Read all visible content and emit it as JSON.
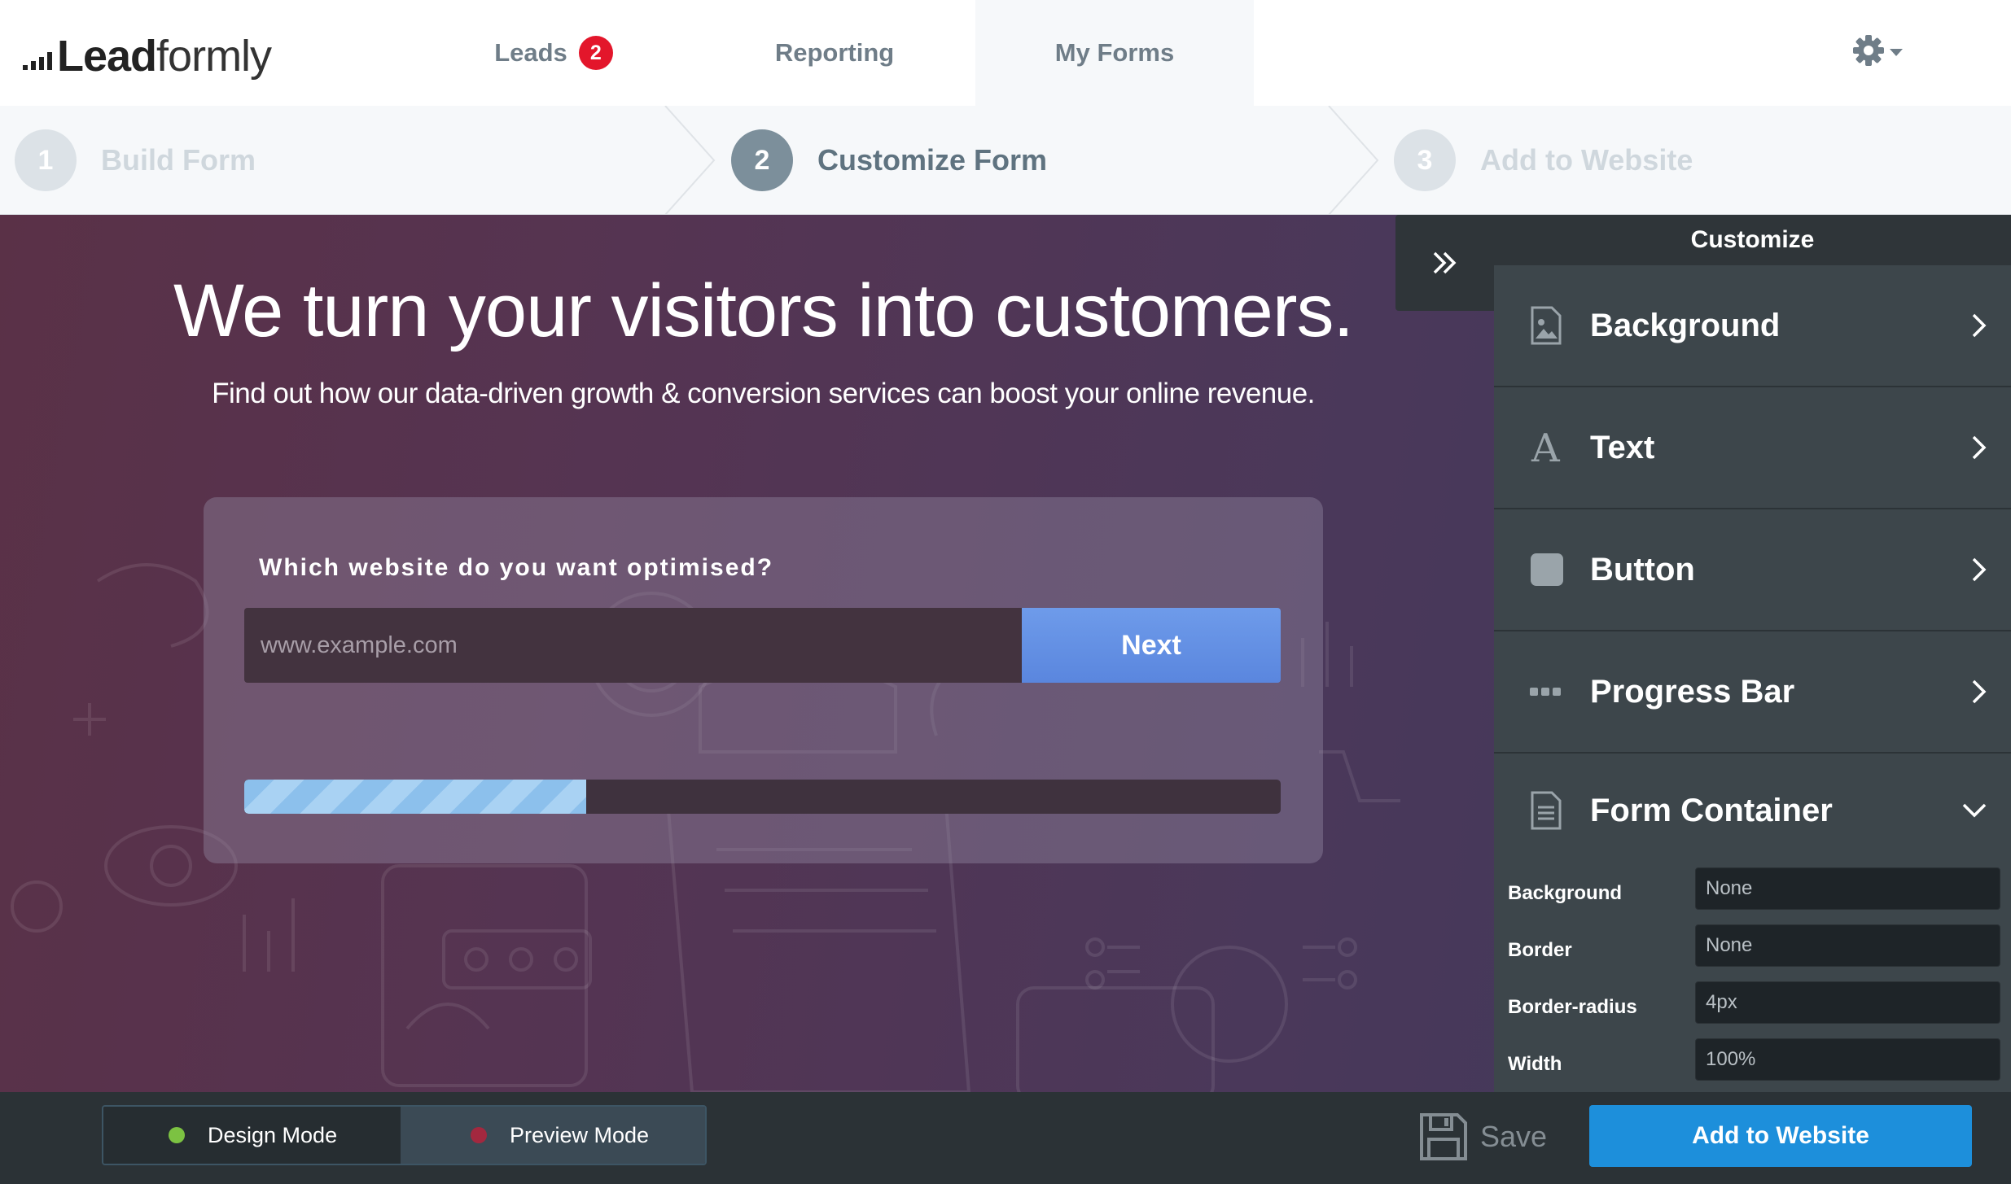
{
  "logo": {
    "bold": "Lead",
    "light": "formly"
  },
  "nav": {
    "tabs": [
      {
        "label": "Leads",
        "badge": "2"
      },
      {
        "label": "Reporting"
      },
      {
        "label": "My Forms",
        "active": true
      }
    ],
    "settings_icon": "gear-icon"
  },
  "steps": [
    {
      "number": "1",
      "label": "Build Form",
      "state": "inactive"
    },
    {
      "number": "2",
      "label": "Customize Form",
      "state": "active"
    },
    {
      "number": "3",
      "label": "Add to Website",
      "state": "inactive"
    }
  ],
  "canvas": {
    "title": "We turn your visitors into customers.",
    "subtitle": "Find out how our data-driven growth & conversion services can boost your online revenue.",
    "form": {
      "question": "Which website do you want optimised?",
      "input_placeholder": "www.example.com",
      "next_label": "Next",
      "progress_fraction": 0.33
    }
  },
  "panel": {
    "title": "Customize",
    "sections": [
      {
        "label": "Background",
        "icon": "image-icon",
        "state": "collapsed"
      },
      {
        "label": "Text",
        "icon": "font-icon",
        "state": "collapsed"
      },
      {
        "label": "Button",
        "icon": "button-icon",
        "state": "collapsed"
      },
      {
        "label": "Progress Bar",
        "icon": "dots-icon",
        "state": "collapsed"
      },
      {
        "label": "Form Container",
        "icon": "document-icon",
        "state": "expanded"
      }
    ],
    "form_container_props": [
      {
        "label": "Background",
        "value": "None"
      },
      {
        "label": "Border",
        "value": "None"
      },
      {
        "label": "Border-radius",
        "value": "4px"
      },
      {
        "label": "Width",
        "value": "100%"
      }
    ]
  },
  "bottom": {
    "design_mode": "Design Mode",
    "preview_mode": "Preview Mode",
    "save": "Save",
    "add_to_website": "Add to Website"
  },
  "colors": {
    "accent_blue": "#1d8fdb",
    "badge_red": "#e3162b",
    "design_dot": "#7cc242",
    "preview_dot": "#a3283f",
    "panel_bg": "#3d464b"
  }
}
